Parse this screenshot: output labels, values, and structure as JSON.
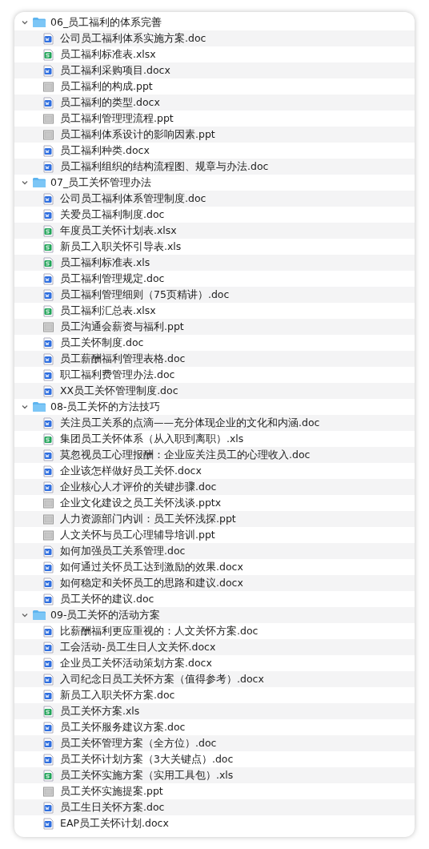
{
  "folders": [
    {
      "name": "06_员工福利的体系完善",
      "expanded": true,
      "children": [
        {
          "name": "公司员工福利体系实施方案.doc",
          "kind": "word"
        },
        {
          "name": "员工福利标准表.xlsx",
          "kind": "excel"
        },
        {
          "name": "员工福利采购项目.docx",
          "kind": "word"
        },
        {
          "name": "员工福利的构成.ppt",
          "kind": "slide"
        },
        {
          "name": "员工福利的类型.docx",
          "kind": "word"
        },
        {
          "name": "员工福利管理理流程.ppt",
          "kind": "slide"
        },
        {
          "name": "员工福利体系设计的影响因素.ppt",
          "kind": "slide"
        },
        {
          "name": "员工福利种类.docx",
          "kind": "word"
        },
        {
          "name": "员工福利组织的结构流程图、规章与办法.doc",
          "kind": "word"
        }
      ]
    },
    {
      "name": "07_员工关怀管理办法",
      "expanded": true,
      "children": [
        {
          "name": "公司员工福利体系管理制度.doc",
          "kind": "word"
        },
        {
          "name": "关爱员工福利制度.doc",
          "kind": "word"
        },
        {
          "name": "年度员工关怀计划表.xlsx",
          "kind": "excel"
        },
        {
          "name": "新员工入职关怀引导表.xls",
          "kind": "excel"
        },
        {
          "name": "员工福利标准表.xls",
          "kind": "excel"
        },
        {
          "name": "员工福利管理规定.doc",
          "kind": "word"
        },
        {
          "name": "员工福利管理细则（75页精讲）.doc",
          "kind": "word"
        },
        {
          "name": "员工福利汇总表.xlsx",
          "kind": "excel"
        },
        {
          "name": "员工沟通会薪资与福利.ppt",
          "kind": "slide"
        },
        {
          "name": "员工关怀制度.doc",
          "kind": "word"
        },
        {
          "name": "员工薪酬福利管理表格.doc",
          "kind": "word"
        },
        {
          "name": "职工福利费管理办法.doc",
          "kind": "word"
        },
        {
          "name": "XX员工关怀管理制度.doc",
          "kind": "word"
        }
      ]
    },
    {
      "name": "08-员工关怀的方法技巧",
      "expanded": true,
      "children": [
        {
          "name": "关注员工关系的点滴——充分体现企业的文化和内涵.doc",
          "kind": "word"
        },
        {
          "name": "集团员工关怀体系（从入职到离职）.xls",
          "kind": "excel"
        },
        {
          "name": "莫忽视员工心理报酬：企业应关注员工的心理收入.doc",
          "kind": "word"
        },
        {
          "name": "企业该怎样做好员工关怀.docx",
          "kind": "word"
        },
        {
          "name": "企业核心人才评价的关键步骤.doc",
          "kind": "word"
        },
        {
          "name": "企业文化建设之员工关怀浅谈.pptx",
          "kind": "slide"
        },
        {
          "name": "人力资源部门内训：员工关怀浅探.ppt",
          "kind": "slide"
        },
        {
          "name": "人文关怀与员工心理辅导培训.ppt",
          "kind": "slide"
        },
        {
          "name": "如何加强员工关系管理.doc",
          "kind": "word"
        },
        {
          "name": "如何通过关怀员工达到激励的效果.docx",
          "kind": "word"
        },
        {
          "name": "如何稳定和关怀员工的思路和建议.docx",
          "kind": "word"
        },
        {
          "name": "员工关怀的建议.doc",
          "kind": "word"
        }
      ]
    },
    {
      "name": "09-员工关怀的活动方案",
      "expanded": true,
      "children": [
        {
          "name": "比薪酬福利更应重视的：人文关怀方案.doc",
          "kind": "word"
        },
        {
          "name": "工会活动-员工生日人文关怀.docx",
          "kind": "word"
        },
        {
          "name": "企业员工关怀活动策划方案.docx",
          "kind": "word"
        },
        {
          "name": "入司纪念日员工关怀方案（值得参考）.docx",
          "kind": "word"
        },
        {
          "name": "新员工入职关怀方案.doc",
          "kind": "word"
        },
        {
          "name": "员工关怀方案.xls",
          "kind": "excel"
        },
        {
          "name": "员工关怀服务建议方案.doc",
          "kind": "word"
        },
        {
          "name": "员工关怀管理方案（全方位）.doc",
          "kind": "word"
        },
        {
          "name": "员工关怀计划方案（3大关键点）.doc",
          "kind": "word"
        },
        {
          "name": "员工关怀实施方案（实用工具包）.xls",
          "kind": "excel"
        },
        {
          "name": "员工关怀实施提案.ppt",
          "kind": "slide"
        },
        {
          "name": "员工生日关怀方案.doc",
          "kind": "word"
        },
        {
          "name": "EAP员工关怀计划.docx",
          "kind": "word"
        }
      ]
    }
  ]
}
